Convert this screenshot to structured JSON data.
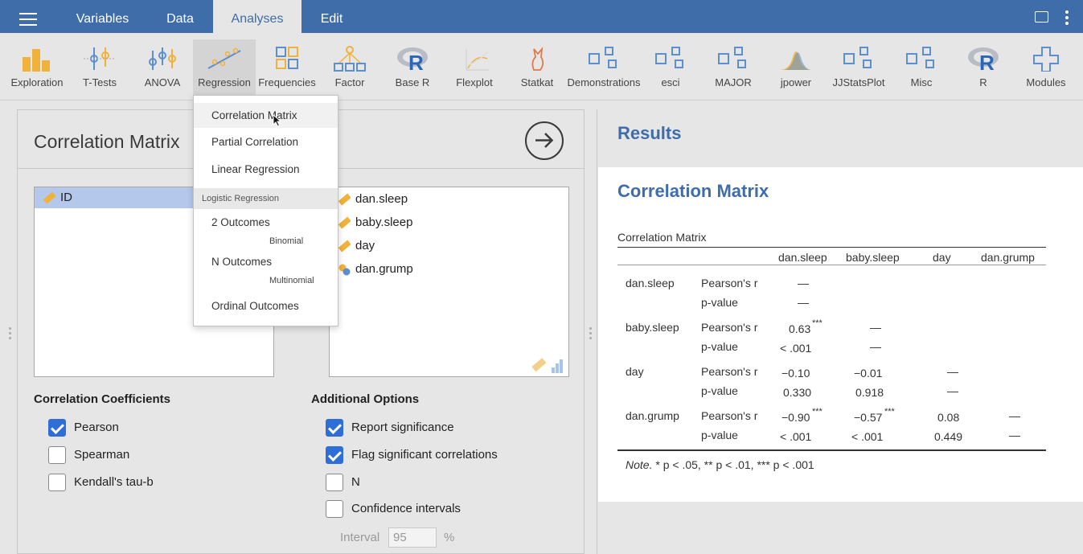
{
  "menubar": {
    "tabs": [
      "Variables",
      "Data",
      "Analyses",
      "Edit"
    ],
    "active_tab": "Analyses"
  },
  "ribbon": {
    "items": [
      {
        "label": "Exploration",
        "icon": "bar-chart-icon"
      },
      {
        "label": "T-Tests",
        "icon": "t-tests-icon"
      },
      {
        "label": "ANOVA",
        "icon": "anova-icon"
      },
      {
        "label": "Regression",
        "icon": "regression-icon"
      },
      {
        "label": "Frequencies",
        "icon": "frequencies-icon"
      },
      {
        "label": "Factor",
        "icon": "factor-icon"
      },
      {
        "label": "Base R",
        "icon": "r-logo-icon"
      },
      {
        "label": "Flexplot",
        "icon": "flexplot-icon"
      },
      {
        "label": "Statkat",
        "icon": "statkat-icon"
      },
      {
        "label": "Demonstrations",
        "icon": "module-icon"
      },
      {
        "label": "esci",
        "icon": "module-icon"
      },
      {
        "label": "MAJOR",
        "icon": "module-icon"
      },
      {
        "label": "jpower",
        "icon": "jpower-icon"
      },
      {
        "label": "JJStatsPlot",
        "icon": "module-icon"
      },
      {
        "label": "Misc",
        "icon": "module-icon"
      },
      {
        "label": "R",
        "icon": "r-logo-icon"
      },
      {
        "label": "Modules",
        "icon": "plus-icon"
      }
    ]
  },
  "analysis": {
    "title": "Correlation Matrix",
    "available_vars": [
      "ID"
    ],
    "selected_vars": [
      "dan.sleep",
      "baby.sleep",
      "day",
      "dan.grump"
    ],
    "coefficients": {
      "title": "Correlation Coefficients",
      "options": [
        {
          "label": "Pearson",
          "checked": true
        },
        {
          "label": "Spearman",
          "checked": false
        },
        {
          "label": "Kendall's tau-b",
          "checked": false
        }
      ]
    },
    "additional": {
      "title": "Additional Options",
      "options": [
        {
          "label": "Report significance",
          "checked": true
        },
        {
          "label": "Flag significant correlations",
          "checked": true
        },
        {
          "label": "N",
          "checked": false
        },
        {
          "label": "Confidence intervals",
          "checked": false
        }
      ],
      "interval_label": "Interval",
      "interval_value": "95",
      "interval_unit": "%"
    }
  },
  "menu": {
    "items": [
      "Correlation Matrix",
      "Partial Correlation",
      "Linear Regression"
    ],
    "header": "Logistic Regression",
    "logistic": [
      {
        "label": "2 Outcomes",
        "sub": "Binomial"
      },
      {
        "label": "N Outcomes",
        "sub": "Multinomial"
      },
      {
        "label": "Ordinal Outcomes",
        "sub": ""
      }
    ]
  },
  "results": {
    "header": "Results",
    "heading": "Correlation Matrix",
    "table_caption": "Correlation Matrix",
    "columns": [
      "dan.sleep",
      "baby.sleep",
      "day",
      "dan.grump"
    ],
    "rows": [
      {
        "var": "dan.sleep",
        "r": [
          "—",
          "",
          "",
          ""
        ],
        "r_sup": [
          "",
          "",
          "",
          ""
        ],
        "p": [
          "—",
          "",
          "",
          ""
        ]
      },
      {
        "var": "baby.sleep",
        "r": [
          "0.63",
          "—",
          "",
          ""
        ],
        "r_sup": [
          "***",
          "",
          "",
          ""
        ],
        "p": [
          "< .001",
          "—",
          "",
          ""
        ]
      },
      {
        "var": "day",
        "r": [
          "−0.10",
          "−0.01",
          "—",
          ""
        ],
        "r_sup": [
          "",
          "",
          "",
          ""
        ],
        "p": [
          "0.330",
          "0.918",
          "—",
          ""
        ]
      },
      {
        "var": "dan.grump",
        "r": [
          "−0.90",
          "−0.57",
          "0.08",
          "—"
        ],
        "r_sup": [
          "***",
          "***",
          "",
          ""
        ],
        "p": [
          "< .001",
          "< .001",
          "0.449",
          "—"
        ]
      }
    ],
    "stat_labels": [
      "Pearson's r",
      "p-value"
    ],
    "note_prefix": "Note.",
    "note_text": " * p < .05, ** p < .01, *** p < .001"
  }
}
